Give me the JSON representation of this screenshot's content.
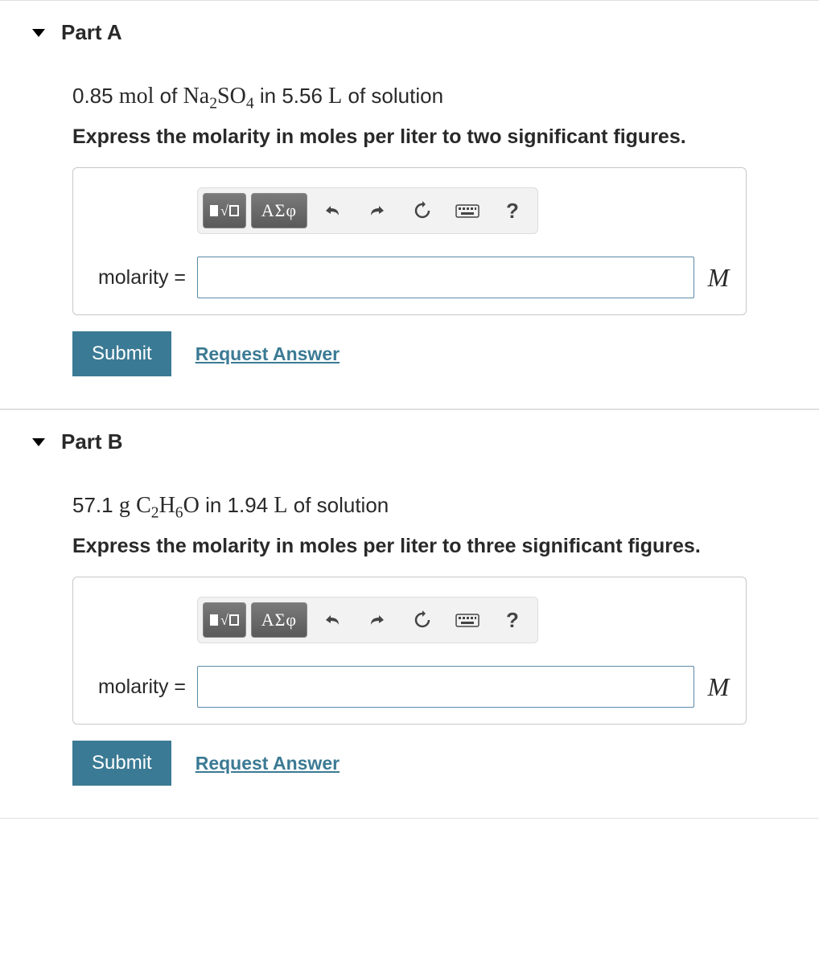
{
  "parts": [
    {
      "title": "Part A",
      "prompt": {
        "amount": "0.85",
        "amount_unit": "mol",
        "of": "of",
        "compound": "Na",
        "compound_sub1": "2",
        "compound_mid": "SO",
        "compound_sub2": "4",
        "in": "in",
        "volume": "5.56",
        "volume_unit": "L",
        "tail": "of solution"
      },
      "instruction": "Express the molarity in moles per liter to two significant figures.",
      "toolbar": {
        "greek": "ΑΣφ",
        "help": "?"
      },
      "label": "molarity =",
      "unit": "M",
      "submit": "Submit",
      "request": "Request Answer"
    },
    {
      "title": "Part B",
      "prompt": {
        "amount": "57.1",
        "amount_unit": "g",
        "of": "",
        "compound": "C",
        "compound_sub1": "2",
        "compound_mid": "H",
        "compound_sub2": "6",
        "compound_tail": "O",
        "in": "in",
        "volume": "1.94",
        "volume_unit": "L",
        "tail": "of solution"
      },
      "instruction": "Express the molarity in moles per liter to three significant figures.",
      "toolbar": {
        "greek": "ΑΣφ",
        "help": "?"
      },
      "label": "molarity =",
      "unit": "M",
      "submit": "Submit",
      "request": "Request Answer"
    }
  ]
}
